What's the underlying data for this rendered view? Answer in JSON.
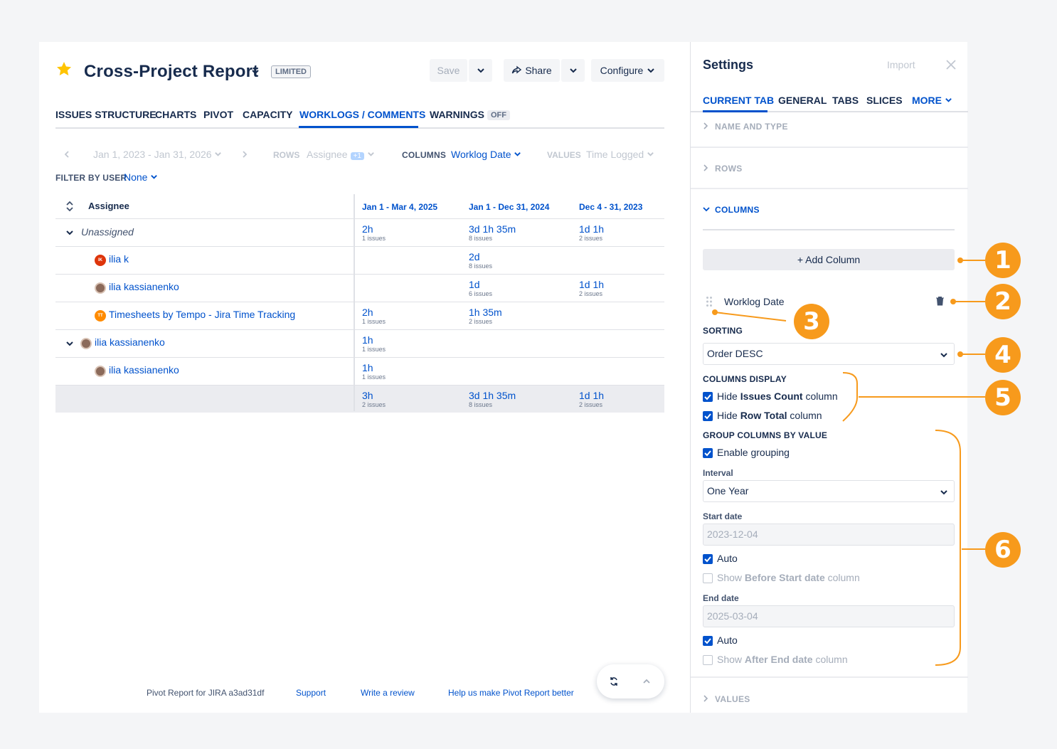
{
  "header": {
    "title": "Cross-Project Report",
    "badge": "LIMITED",
    "save_label": "Save",
    "share_label": "Share",
    "configure_label": "Configure"
  },
  "tabs": [
    {
      "label": "ISSUES STRUCTURE"
    },
    {
      "label": "CHARTS"
    },
    {
      "label": "PIVOT"
    },
    {
      "label": "CAPACITY"
    },
    {
      "label": "WORKLOGS / COMMENTS",
      "active": true
    },
    {
      "label": "WARNINGS",
      "badge": "OFF"
    }
  ],
  "toolbar": {
    "date_range": "Jan 1, 2023 - Jan 31, 2026",
    "rows_label": "ROWS",
    "rows_value": "Assignee",
    "rows_count": "+1",
    "columns_label": "COLUMNS",
    "columns_value": "Worklog Date",
    "values_label": "VALUES",
    "values_value": "Time Logged",
    "filter_label": "FILTER BY USER",
    "filter_value": "None"
  },
  "table": {
    "header_first": "Assignee",
    "columns": [
      "Jan 1 - Mar 4, 2025",
      "Jan 1 - Dec 31, 2024",
      "Dec 4 - 31, 2023"
    ],
    "rows": [
      {
        "name": "Unassigned",
        "cells": [
          {
            "v": "2h",
            "s": "1 issues"
          },
          {
            "v": "3d 1h 35m",
            "s": "8 issues"
          },
          {
            "v": "1d 1h",
            "s": "2 issues"
          }
        ]
      },
      {
        "name": "ilia k",
        "avatar_text": "IK",
        "cells": [
          null,
          {
            "v": "2d",
            "s": "8 issues"
          },
          null
        ]
      },
      {
        "name": "ilia kassianenko",
        "cells": [
          null,
          {
            "v": "1d",
            "s": "6 issues"
          },
          {
            "v": "1d 1h",
            "s": "2 issues"
          }
        ]
      },
      {
        "name": "Timesheets by Tempo - Jira Time Tracking",
        "avatar_text": "TT",
        "cells": [
          {
            "v": "2h",
            "s": "1 issues"
          },
          {
            "v": "1h 35m",
            "s": "2 issues"
          },
          null
        ]
      },
      {
        "name": "ilia kassianenko",
        "cells": [
          {
            "v": "1h",
            "s": "1 issues"
          },
          null,
          null
        ]
      },
      {
        "name": "ilia kassianenko",
        "cells": [
          {
            "v": "1h",
            "s": "1 issues"
          },
          null,
          null
        ]
      },
      {
        "name": "",
        "cells": [
          {
            "v": "3h",
            "s": "2 issues"
          },
          {
            "v": "3d 1h 35m",
            "s": "8 issues"
          },
          {
            "v": "1d 1h",
            "s": "2 issues"
          }
        ]
      }
    ]
  },
  "footer": {
    "version": "Pivot Report for JIRA a3ad31df",
    "support": "Support",
    "review": "Write a review",
    "help": "Help us make Pivot Report better"
  },
  "settings": {
    "title": "Settings",
    "import_label": "Import",
    "tabs": [
      "CURRENT TAB",
      "GENERAL",
      "TABS",
      "SLICES",
      "MORE"
    ],
    "sections": {
      "name_type": "NAME AND TYPE",
      "rows": "ROWS",
      "columns": "COLUMNS",
      "values": "VALUES"
    },
    "add_column": "+ Add Column",
    "column_item": "Worklog Date",
    "sorting_label": "SORTING",
    "sorting_value": "Order DESC",
    "columns_display_label": "COLUMNS DISPLAY",
    "hide_issues_pre": "Hide ",
    "hide_issues_bold": "Issues Count",
    "hide_issues_post": " column",
    "hide_total_pre": "Hide ",
    "hide_total_bold": "Row Total",
    "hide_total_post": " column",
    "group_label": "GROUP COLUMNS BY VALUE",
    "enable_grouping": "Enable grouping",
    "interval_label": "Interval",
    "interval_value": "One Year",
    "start_label": "Start date",
    "start_value": "2023-12-04",
    "auto_label": "Auto",
    "before_pre": "Show ",
    "before_bold": "Before Start date",
    "before_post": " column",
    "end_label": "End date",
    "end_value": "2025-03-04",
    "auto2_label": "Auto",
    "after_pre": "Show ",
    "after_bold": "After End date",
    "after_post": " column"
  },
  "callouts": [
    "1",
    "2",
    "3",
    "4",
    "5",
    "6"
  ],
  "colors": {
    "accent": "#0052cc",
    "callout": "#f79a1c",
    "star": "#ffc400"
  }
}
